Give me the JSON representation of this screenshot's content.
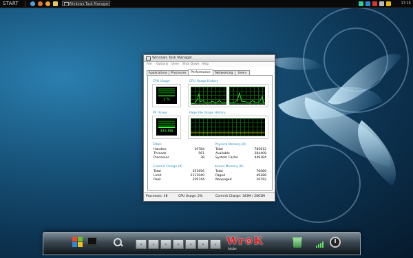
{
  "topbar": {
    "start_label": "START",
    "task_label": "Windows Task Manager",
    "clock": "17:15"
  },
  "window": {
    "title": "Windows Task Manager",
    "menu": [
      "File",
      "Options",
      "View",
      "Shut Down",
      "Help"
    ],
    "tabs": [
      {
        "label": "Applications",
        "active": false
      },
      {
        "label": "Processes",
        "active": false
      },
      {
        "label": "Performance",
        "active": true
      },
      {
        "label": "Networking",
        "active": false
      },
      {
        "label": "Users",
        "active": false
      }
    ],
    "cpu_usage": {
      "label": "CPU Usage",
      "value": "2 %",
      "percent": 2
    },
    "cpu_history": {
      "label": "CPU Usage History"
    },
    "pf_usage": {
      "label": "PF Usage",
      "value": "343 MB"
    },
    "pf_history": {
      "label": "Page File Usage History"
    },
    "totals": {
      "label": "Totals",
      "rows": [
        {
          "k": "Handles",
          "v": "10784"
        },
        {
          "k": "Threads",
          "v": "561"
        },
        {
          "k": "Processes",
          "v": "38"
        }
      ]
    },
    "physical_memory": {
      "label": "Physical Memory (K)",
      "rows": [
        {
          "k": "Total",
          "v": "785612"
        },
        {
          "k": "Available",
          "v": "384408"
        },
        {
          "k": "System Cache",
          "v": "449384"
        }
      ]
    },
    "commit_charge": {
      "label": "Commit Charge (K)",
      "rows": [
        {
          "k": "Total",
          "v": "351656"
        },
        {
          "k": "Limit",
          "v": "2111040"
        },
        {
          "k": "Peak",
          "v": "359744"
        }
      ]
    },
    "kernel_memory": {
      "label": "Kernel Memory (K)",
      "rows": [
        {
          "k": "Total",
          "v": "76080"
        },
        {
          "k": "Paged",
          "v": "49288"
        },
        {
          "k": "Nonpaged",
          "v": "26792"
        }
      ]
    },
    "status": {
      "processes": "Processes: 38",
      "cpu": "CPU Usage: 2%",
      "commit": "Commit Charge: 343M / 2061M"
    }
  },
  "dock": {
    "buttons": [
      "⌄",
      "⌄",
      "⌄",
      "⌄",
      "⌄",
      "⌄",
      "⌄"
    ],
    "logo_text": "Wr⊙K",
    "logo_sub": "Adobe"
  },
  "colors": {
    "accent_blue": "#2a8fc0",
    "graph_green": "#39ff39",
    "grid_green": "#0b5d0b"
  }
}
